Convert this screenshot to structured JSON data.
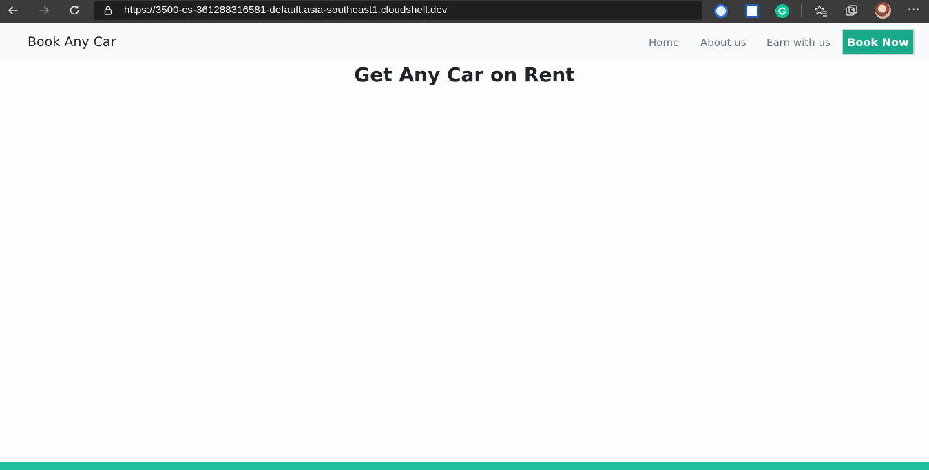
{
  "browser": {
    "url": "https://3500-cs-361288316581-default.asia-southeast1.cloudshell.dev",
    "icons": [
      "back-icon",
      "forward-icon",
      "reload-icon",
      "lock-icon",
      "add-favorite-icon",
      "extension-icon",
      "favorites-icon",
      "collections-icon",
      "profile-avatar",
      "more-icon"
    ]
  },
  "navbar": {
    "brand": "Book Any Car",
    "links": [
      "Home",
      "About us",
      "Earn with us"
    ],
    "cta": "Book Now"
  },
  "main": {
    "title": "Get Any Car on Rent"
  },
  "colors": {
    "accent": "#17a989",
    "footer": "#1fbf9e",
    "navbar_bg": "#f8f9fa",
    "chrome_bg": "#3b3b3b"
  }
}
